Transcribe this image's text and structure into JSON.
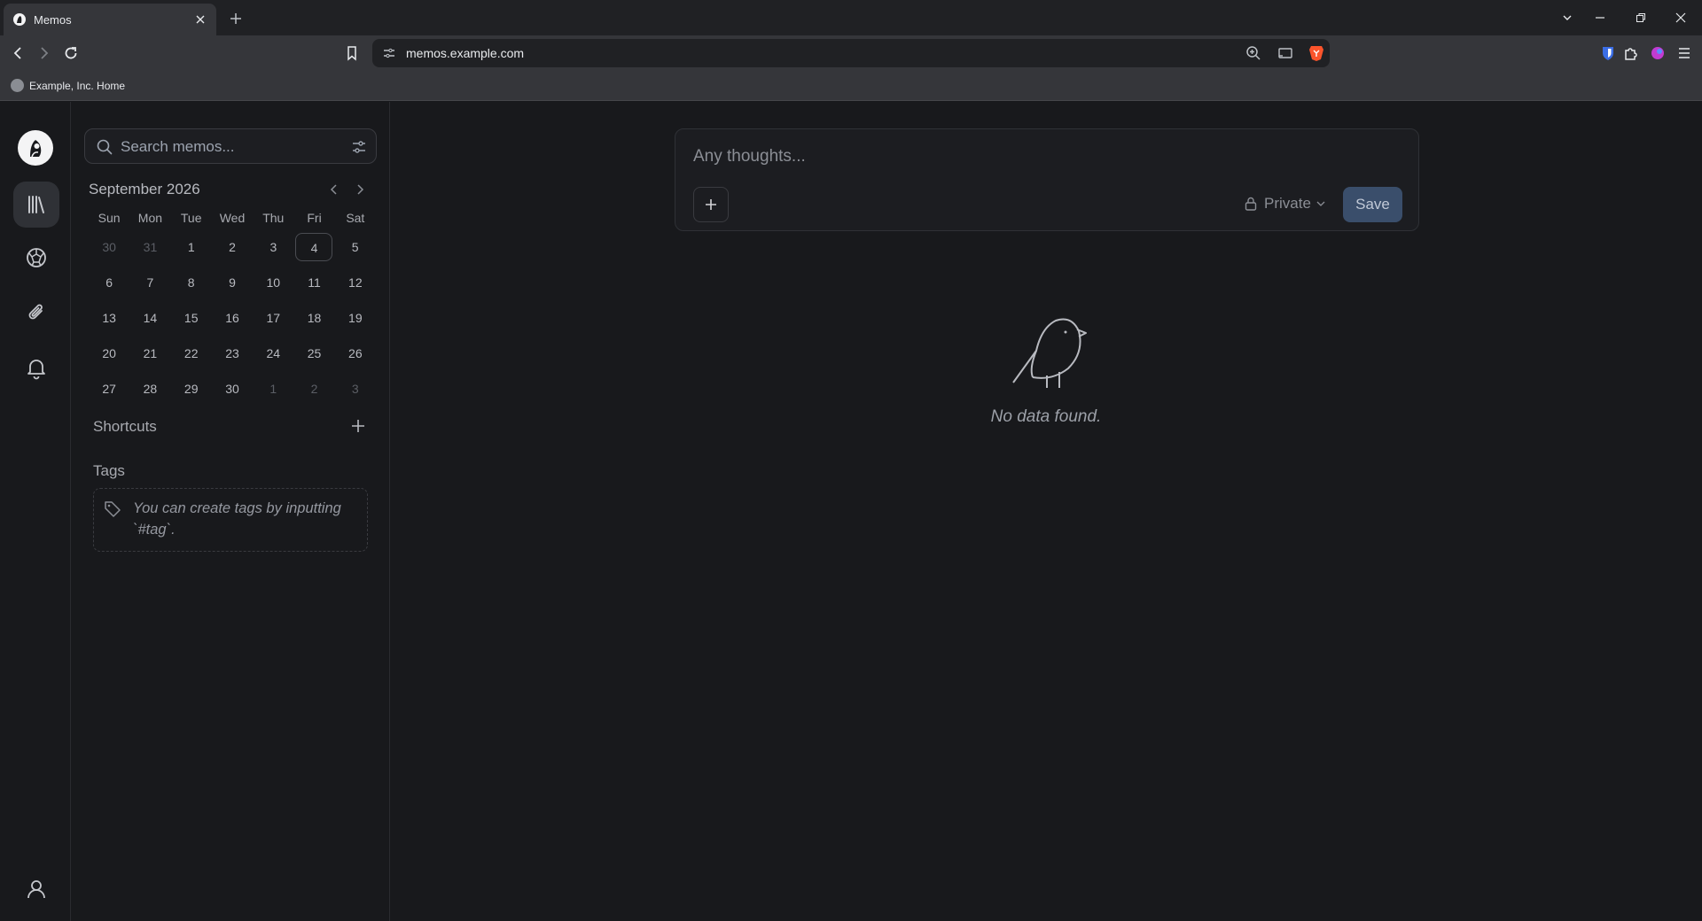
{
  "browser": {
    "tab_title": "Memos",
    "url": "memos.example.com",
    "bookmark_label": "Example, Inc. Home"
  },
  "sidebar": {
    "search_placeholder": "Search memos...",
    "calendar": {
      "month_label": "September 2026",
      "weekdays": [
        "Sun",
        "Mon",
        "Tue",
        "Wed",
        "Thu",
        "Fri",
        "Sat"
      ],
      "weeks": [
        [
          "30",
          "31",
          "1",
          "2",
          "3",
          "4",
          "5"
        ],
        [
          "6",
          "7",
          "8",
          "9",
          "10",
          "11",
          "12"
        ],
        [
          "13",
          "14",
          "15",
          "16",
          "17",
          "18",
          "19"
        ],
        [
          "20",
          "21",
          "22",
          "23",
          "24",
          "25",
          "26"
        ],
        [
          "27",
          "28",
          "29",
          "30",
          "1",
          "2",
          "3"
        ]
      ]
    },
    "shortcuts_title": "Shortcuts",
    "tags_title": "Tags",
    "tags_hint": "You can create tags by inputting `#tag`."
  },
  "editor": {
    "placeholder": "Any thoughts...",
    "visibility_label": "Private",
    "save_label": "Save"
  },
  "empty_state": {
    "message": "No data found."
  }
}
